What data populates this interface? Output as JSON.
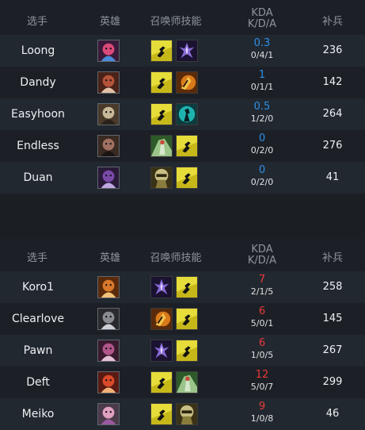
{
  "headers": {
    "player": "选手",
    "hero": "英雄",
    "spells": "召唤师技能",
    "kda_title": "KDA",
    "kda_sub": "K/D/A",
    "cs": "补兵"
  },
  "teams": [
    {
      "side": "blue",
      "players": [
        {
          "name": "Loong",
          "kda": "0.3",
          "kda_detail": "0/4/1",
          "cs": "236",
          "hero_icon": "champion-portrait-icon",
          "spells": [
            "flash-icon",
            "smite-icon"
          ]
        },
        {
          "name": "Dandy",
          "kda": "1",
          "kda_detail": "0/1/1",
          "cs": "142",
          "hero_icon": "champion-portrait-icon",
          "spells": [
            "flash-icon",
            "ignite-icon"
          ]
        },
        {
          "name": "Easyhoon",
          "kda": "0.5",
          "kda_detail": "1/2/0",
          "cs": "264",
          "hero_icon": "champion-portrait-icon",
          "spells": [
            "flash-icon",
            "ghost-icon"
          ]
        },
        {
          "name": "Endless",
          "kda": "0",
          "kda_detail": "0/2/0",
          "cs": "276",
          "hero_icon": "champion-portrait-icon",
          "spells": [
            "heal-icon",
            "flash-icon"
          ]
        },
        {
          "name": "Duan",
          "kda": "0",
          "kda_detail": "0/2/0",
          "cs": "41",
          "hero_icon": "champion-portrait-icon",
          "spells": [
            "exhaust-icon",
            "flash-icon"
          ]
        }
      ]
    },
    {
      "side": "red",
      "players": [
        {
          "name": "Koro1",
          "kda": "7",
          "kda_detail": "2/1/5",
          "cs": "258",
          "hero_icon": "champion-portrait-icon",
          "spells": [
            "smite-icon",
            "flash-icon"
          ]
        },
        {
          "name": "Clearlove",
          "kda": "6",
          "kda_detail": "5/0/1",
          "cs": "145",
          "hero_icon": "champion-portrait-icon",
          "spells": [
            "ignite-icon",
            "flash-icon"
          ]
        },
        {
          "name": "Pawn",
          "kda": "6",
          "kda_detail": "1/0/5",
          "cs": "267",
          "hero_icon": "champion-portrait-icon",
          "spells": [
            "smite-icon",
            "flash-icon"
          ]
        },
        {
          "name": "Deft",
          "kda": "12",
          "kda_detail": "5/0/7",
          "cs": "299",
          "hero_icon": "champion-portrait-icon",
          "spells": [
            "flash-icon",
            "heal-icon"
          ]
        },
        {
          "name": "Meiko",
          "kda": "9",
          "kda_detail": "1/0/8",
          "cs": "46",
          "hero_icon": "champion-portrait-icon",
          "spells": [
            "flash-icon",
            "exhaust-icon"
          ]
        }
      ]
    }
  ],
  "colors": {
    "background": "#1b1f24",
    "row_alt": "#222830",
    "header_text": "#8e949c",
    "blue_kda": "#2b90e8",
    "red_kda": "#e83a3a"
  }
}
